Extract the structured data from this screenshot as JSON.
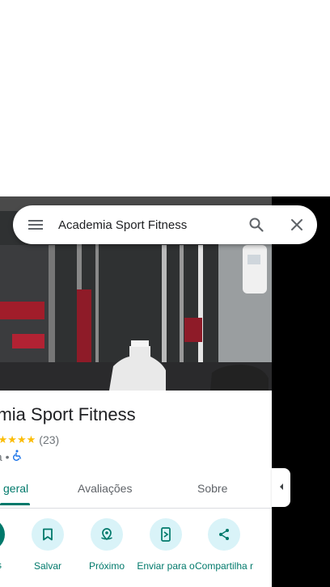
{
  "search": {
    "query": "Academia Sport Fitness"
  },
  "place": {
    "name": "Academia Sport Fitness",
    "name_visible": "demia Sport Fitness",
    "stars": "★★★★★",
    "reviews_count": "(23)",
    "category_visible": "nia •"
  },
  "tabs": [
    {
      "label": "geral"
    },
    {
      "label": "Avaliações"
    },
    {
      "label": "Sobre"
    }
  ],
  "actions": {
    "first_label_visible": "s",
    "items": [
      {
        "label": "Salvar",
        "icon": "bookmark-icon"
      },
      {
        "label": "Próximo",
        "icon": "nearby-icon"
      },
      {
        "label": "Enviar para o",
        "icon": "send-to-phone-icon"
      },
      {
        "label": "Compartilha r",
        "icon": "share-icon"
      }
    ]
  },
  "colors": {
    "accent": "#00796b",
    "action_bg": "#d9f3f8",
    "star": "#fbbc04",
    "accessible": "#1a73e8"
  }
}
